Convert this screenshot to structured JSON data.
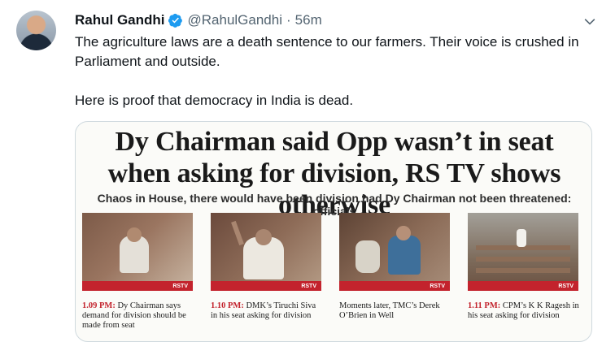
{
  "tweet": {
    "author_name": "Rahul Gandhi",
    "author_handle": "@RahulGandhi",
    "separator": "·",
    "time": "56m",
    "text_line1": "The agriculture laws are a death sentence to our farmers. Their voice is crushed in Parliament and outside.",
    "text_line2": "Here is proof that democracy in India is dead."
  },
  "card": {
    "headline": "Dy Chairman said Opp wasn’t in seat when asking for division, RS TV shows otherwise",
    "subhead": "Chaos in House, there would have been division had Dy Chairman not been threatened: officials",
    "photos": [
      {
        "time": "1.09 PM:",
        "caption": " Dy Chairman says demand for division should be made from seat"
      },
      {
        "time": "1.10 PM:",
        "caption": " DMK’s Tiruchi Siva in his seat asking for division"
      },
      {
        "time": "",
        "caption": "Moments later, TMC’s Derek O’Brien in Well"
      },
      {
        "time": "1.11 PM:",
        "caption": " CPM’s K K Ragesh in his seat asking for division"
      }
    ],
    "tv_logo": "RSTV"
  },
  "colors": {
    "accent": "#1d9bf0",
    "muted": "#536471",
    "red": "#c3232d"
  }
}
